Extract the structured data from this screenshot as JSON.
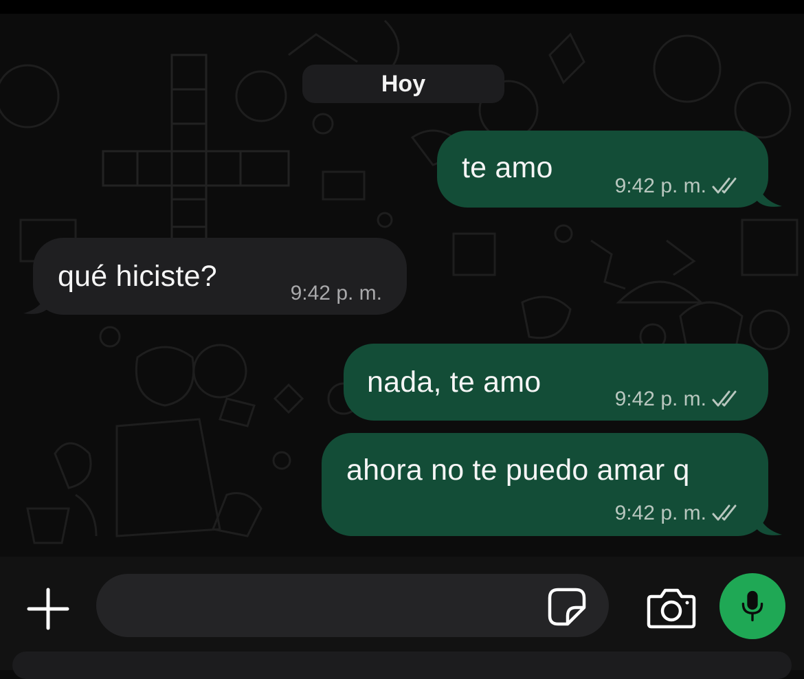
{
  "date_chip": "Hoy",
  "messages": [
    {
      "text": "te amo",
      "time": "9:42 p. m.",
      "direction": "outgoing",
      "status": "read-double-check"
    },
    {
      "text": "qué hiciste?",
      "time": "9:42 p. m.",
      "direction": "incoming"
    },
    {
      "text": "nada, te amo",
      "time": "9:42 p. m.",
      "direction": "outgoing",
      "status": "read-double-check"
    },
    {
      "text": "ahora no te puedo amar q",
      "time": "9:42 p. m.",
      "direction": "outgoing",
      "status": "read-double-check"
    }
  ],
  "composer": {
    "placeholder": "",
    "icons": [
      "plus-icon",
      "sticker-icon",
      "camera-icon",
      "microphone-icon"
    ]
  },
  "colors": {
    "outgoing_bubble": "#134d37",
    "incoming_bubble": "#1f1f21",
    "mic_button": "#1fa855",
    "background": "#0c0c0c"
  }
}
